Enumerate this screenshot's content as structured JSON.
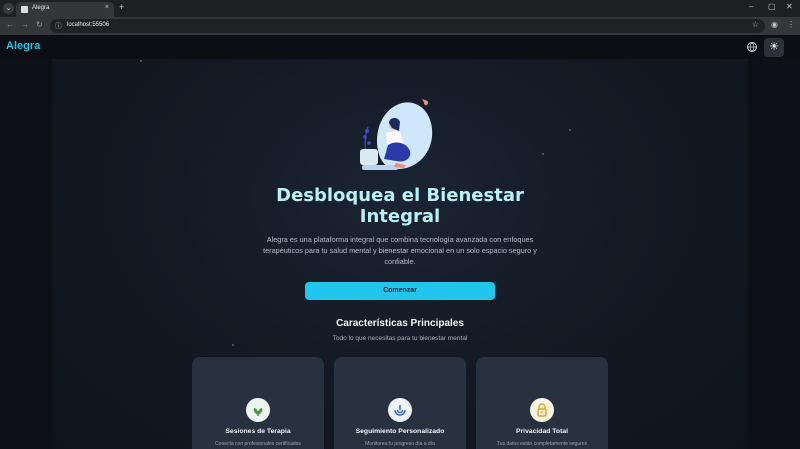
{
  "browser": {
    "tab_title": "Alegra",
    "tab_close": "×",
    "new_tab": "+",
    "url": "localhost:55506",
    "window_controls": [
      "–",
      "▢",
      "✕"
    ]
  },
  "nav": {
    "brand": "Alegra",
    "theme_icon": "☀"
  },
  "hero": {
    "title": "Desbloquea el Bienestar Integral",
    "description": "Alegra es una plataforma integral que combina tecnología avanzada con enfoques terapéuticos para tu salud mental y bienestar emocional en un solo espacio seguro y confiable.",
    "cta_label": "Comenzar"
  },
  "features": {
    "title": "Características Principales",
    "subtitle": "Todo lo que necesitas para tu bienestar mental",
    "cards": [
      {
        "title": "Sesiones de Terapia",
        "desc": "Conecta con profesionales certificados",
        "icon": "sprout-icon",
        "color": "#4a9a3c"
      },
      {
        "title": "Seguimiento Personalizado",
        "desc": "Monitorea tu progreso día a día",
        "icon": "tracking-icon",
        "color": "#3b6fd8"
      },
      {
        "title": "Privacidad Total",
        "desc": "Tus datos están completamente seguros",
        "icon": "lock-icon",
        "color": "#e0a526"
      }
    ]
  },
  "colors": {
    "accent": "#22c5ee",
    "brand": "#22c3e6",
    "hero_title": "#b9f0f7",
    "card_bg": "#283140"
  }
}
